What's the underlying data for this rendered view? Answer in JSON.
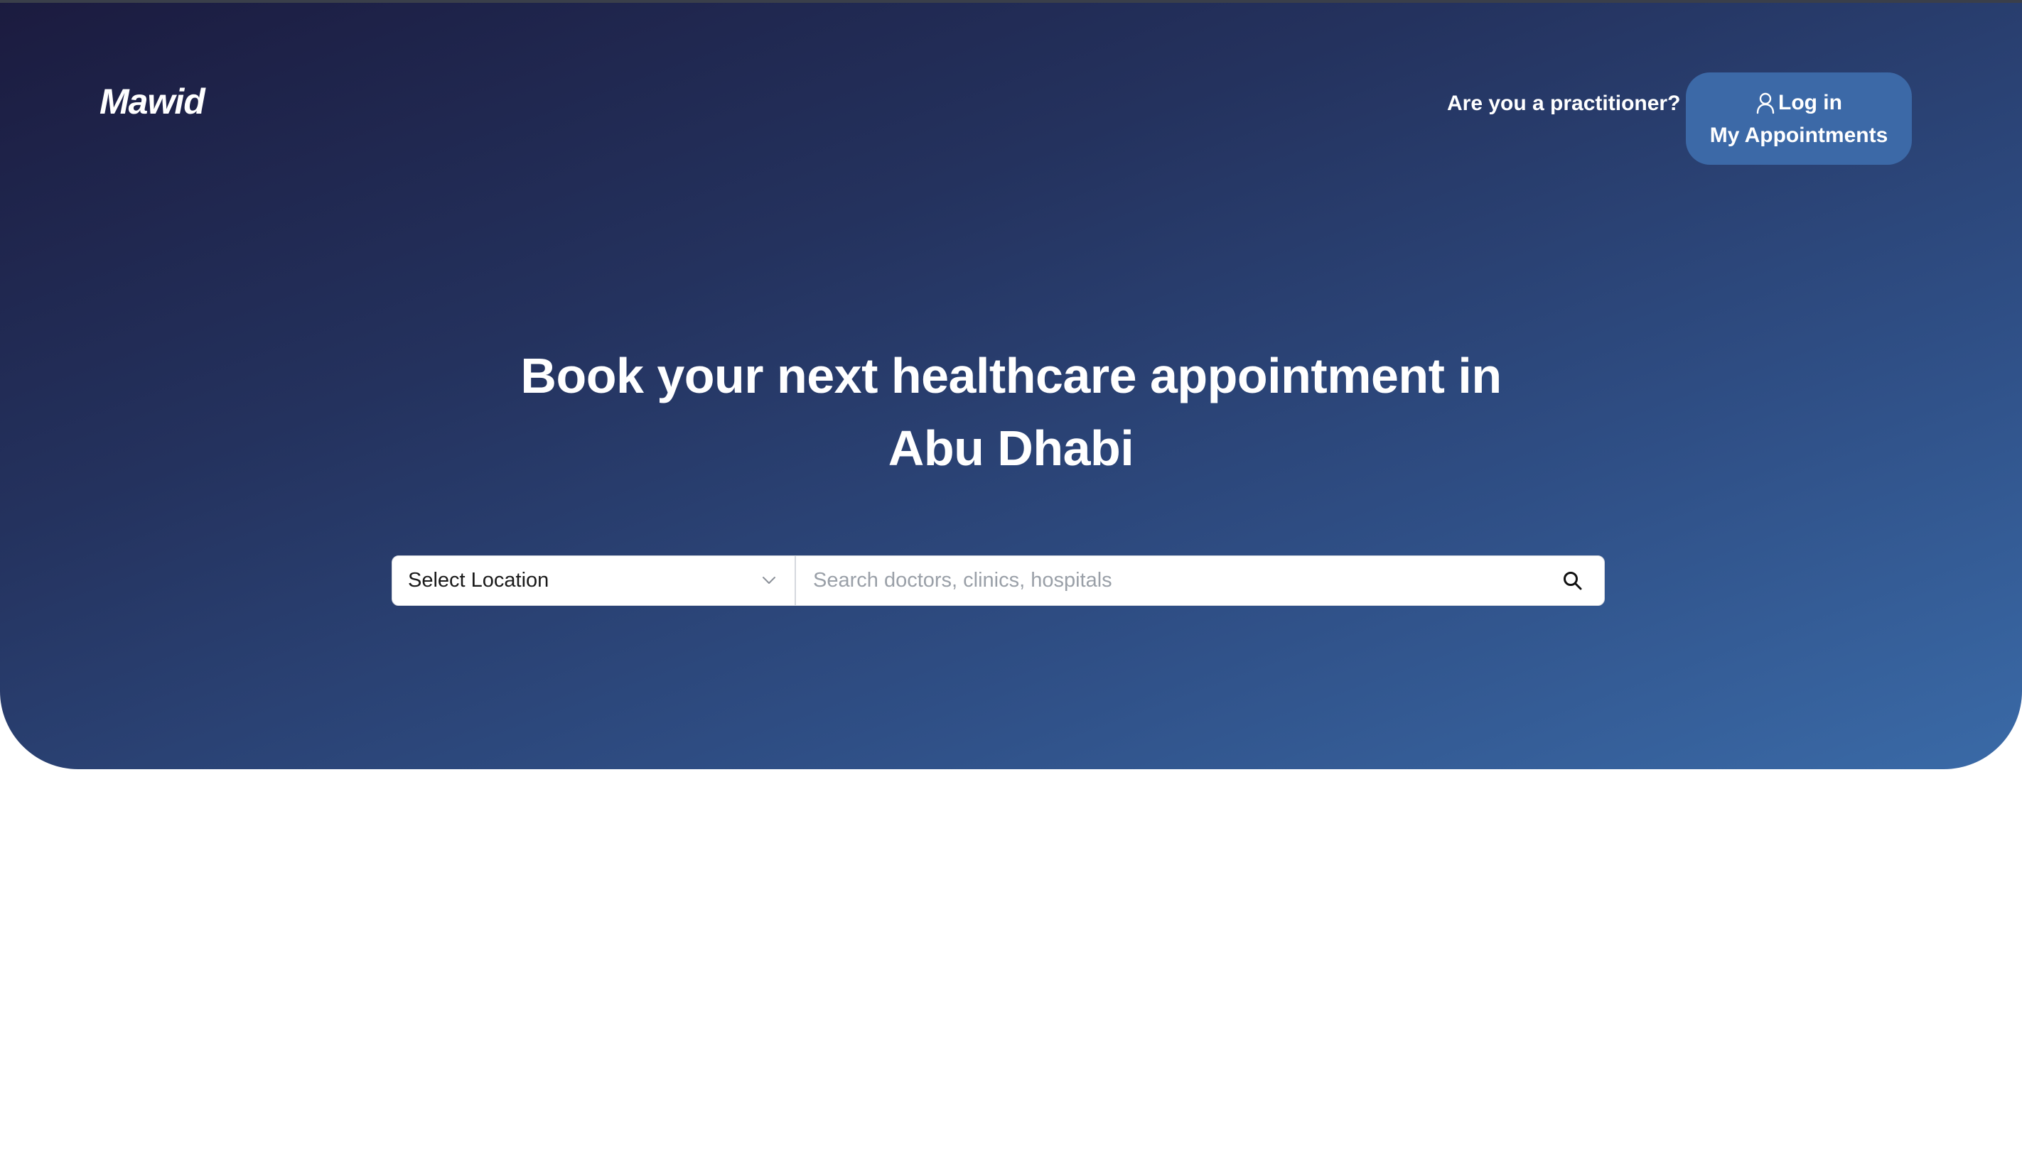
{
  "brand": {
    "logo_text": "Mawid"
  },
  "header": {
    "practitioner_link": "Are you a practitioner?",
    "login_button": {
      "icon": "user-icon",
      "login_label": "Log in",
      "appointments_label": "My Appointments"
    }
  },
  "hero": {
    "headline_line1": "Book your next healthcare appointment in",
    "headline_line2": "Abu Dhabi"
  },
  "search": {
    "location_label": "Select Location",
    "location_icon": "chevron-down-icon",
    "placeholder": "Search doctors, clinics, hospitals",
    "value": "",
    "search_icon": "search-icon"
  },
  "colors": {
    "hero_gradient_start": "#1b1b3f",
    "hero_gradient_end": "#3a6aa7",
    "button_bg": "#3c69a7",
    "text_on_dark": "#ffffff"
  }
}
